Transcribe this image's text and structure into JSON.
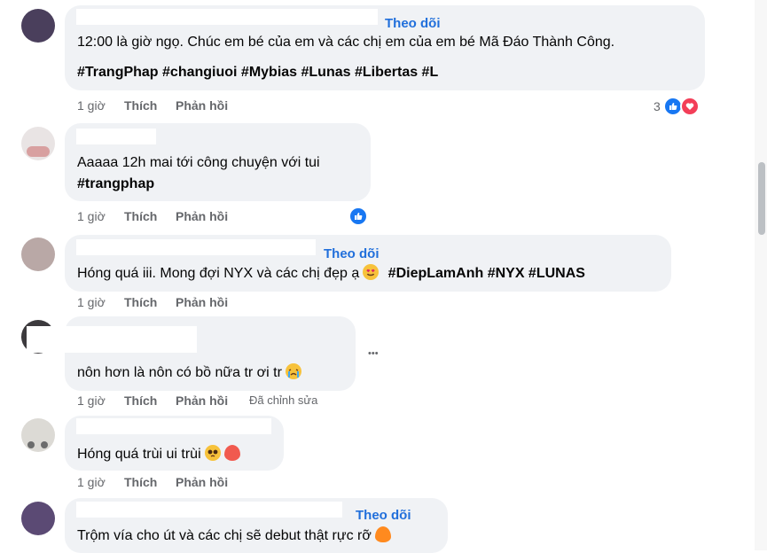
{
  "comments": [
    {
      "follow": "Theo dõi",
      "lines": [
        "12:00 là giờ ngọ. Chúc em bé của em và các chị em của em bé Mã Đáo Thành Công."
      ],
      "tags": "#TrangPhap #changiuoi #Mybias #Lunas #Libertas #L",
      "time": "1 giờ",
      "like": "Thích",
      "reply": "Phản hồi",
      "reaction_count": "3"
    },
    {
      "lines": [
        "Aaaaa 12h mai tới công chuyện với tui"
      ],
      "tags": "#trangphap",
      "time": "1 giờ",
      "like": "Thích",
      "reply": "Phản hồi"
    },
    {
      "follow": "Theo dõi",
      "text": "Hóng quá iii. Mong đợi NYX và các chị đẹp ạ",
      "tags": "#DiepLamAnh #NYX #LUNAS",
      "time": "1 giờ",
      "like": "Thích",
      "reply": "Phản hồi"
    },
    {
      "text": "nôn hơn là nôn có bồ nữa tr ơi tr",
      "time": "1 giờ",
      "like": "Thích",
      "reply": "Phản hồi",
      "edited": "Đã chỉnh sửa",
      "more": "•••"
    },
    {
      "text": "Hóng quá trùi ui trùi",
      "time": "1 giờ",
      "like": "Thích",
      "reply": "Phản hồi"
    },
    {
      "follow": "Theo dõi",
      "text": "Trộm vía cho út và các chị sẽ debut thật rực rỡ"
    }
  ],
  "icons": [
    "like-icon",
    "love-icon",
    "heart-eyes-emoji",
    "crying-emoji",
    "pleading-emoji",
    "fire-emoji",
    "peach-emoji"
  ],
  "colors": {
    "link": "#216fdb",
    "bubble": "#f0f2f5",
    "meta": "#65676b",
    "like": "#1877f2",
    "love": "#f33e58"
  }
}
